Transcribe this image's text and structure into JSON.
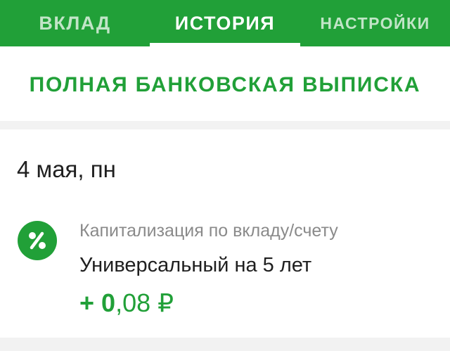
{
  "tabs": [
    {
      "label": "ВКЛАД",
      "active": false
    },
    {
      "label": "ИСТОРИЯ",
      "active": true
    },
    {
      "label": "НАСТРОЙКИ",
      "active": false
    }
  ],
  "statement": {
    "link_label": "ПОЛНАЯ БАНКОВСКАЯ ВЫПИСКА"
  },
  "history": {
    "day_label": "4 мая, пн",
    "operations": [
      {
        "icon": "percent-icon",
        "category": "Капитализация по вкладу/счету",
        "name": "Универсальный на 5 лет",
        "amount_sign": "+ ",
        "amount_integer": "0",
        "amount_fraction": ",08 ₽"
      }
    ]
  },
  "colors": {
    "brand_green": "#21a038",
    "background": "#f2f2f2",
    "text_primary": "#1f1f1f",
    "text_secondary": "#8a8a8a"
  }
}
